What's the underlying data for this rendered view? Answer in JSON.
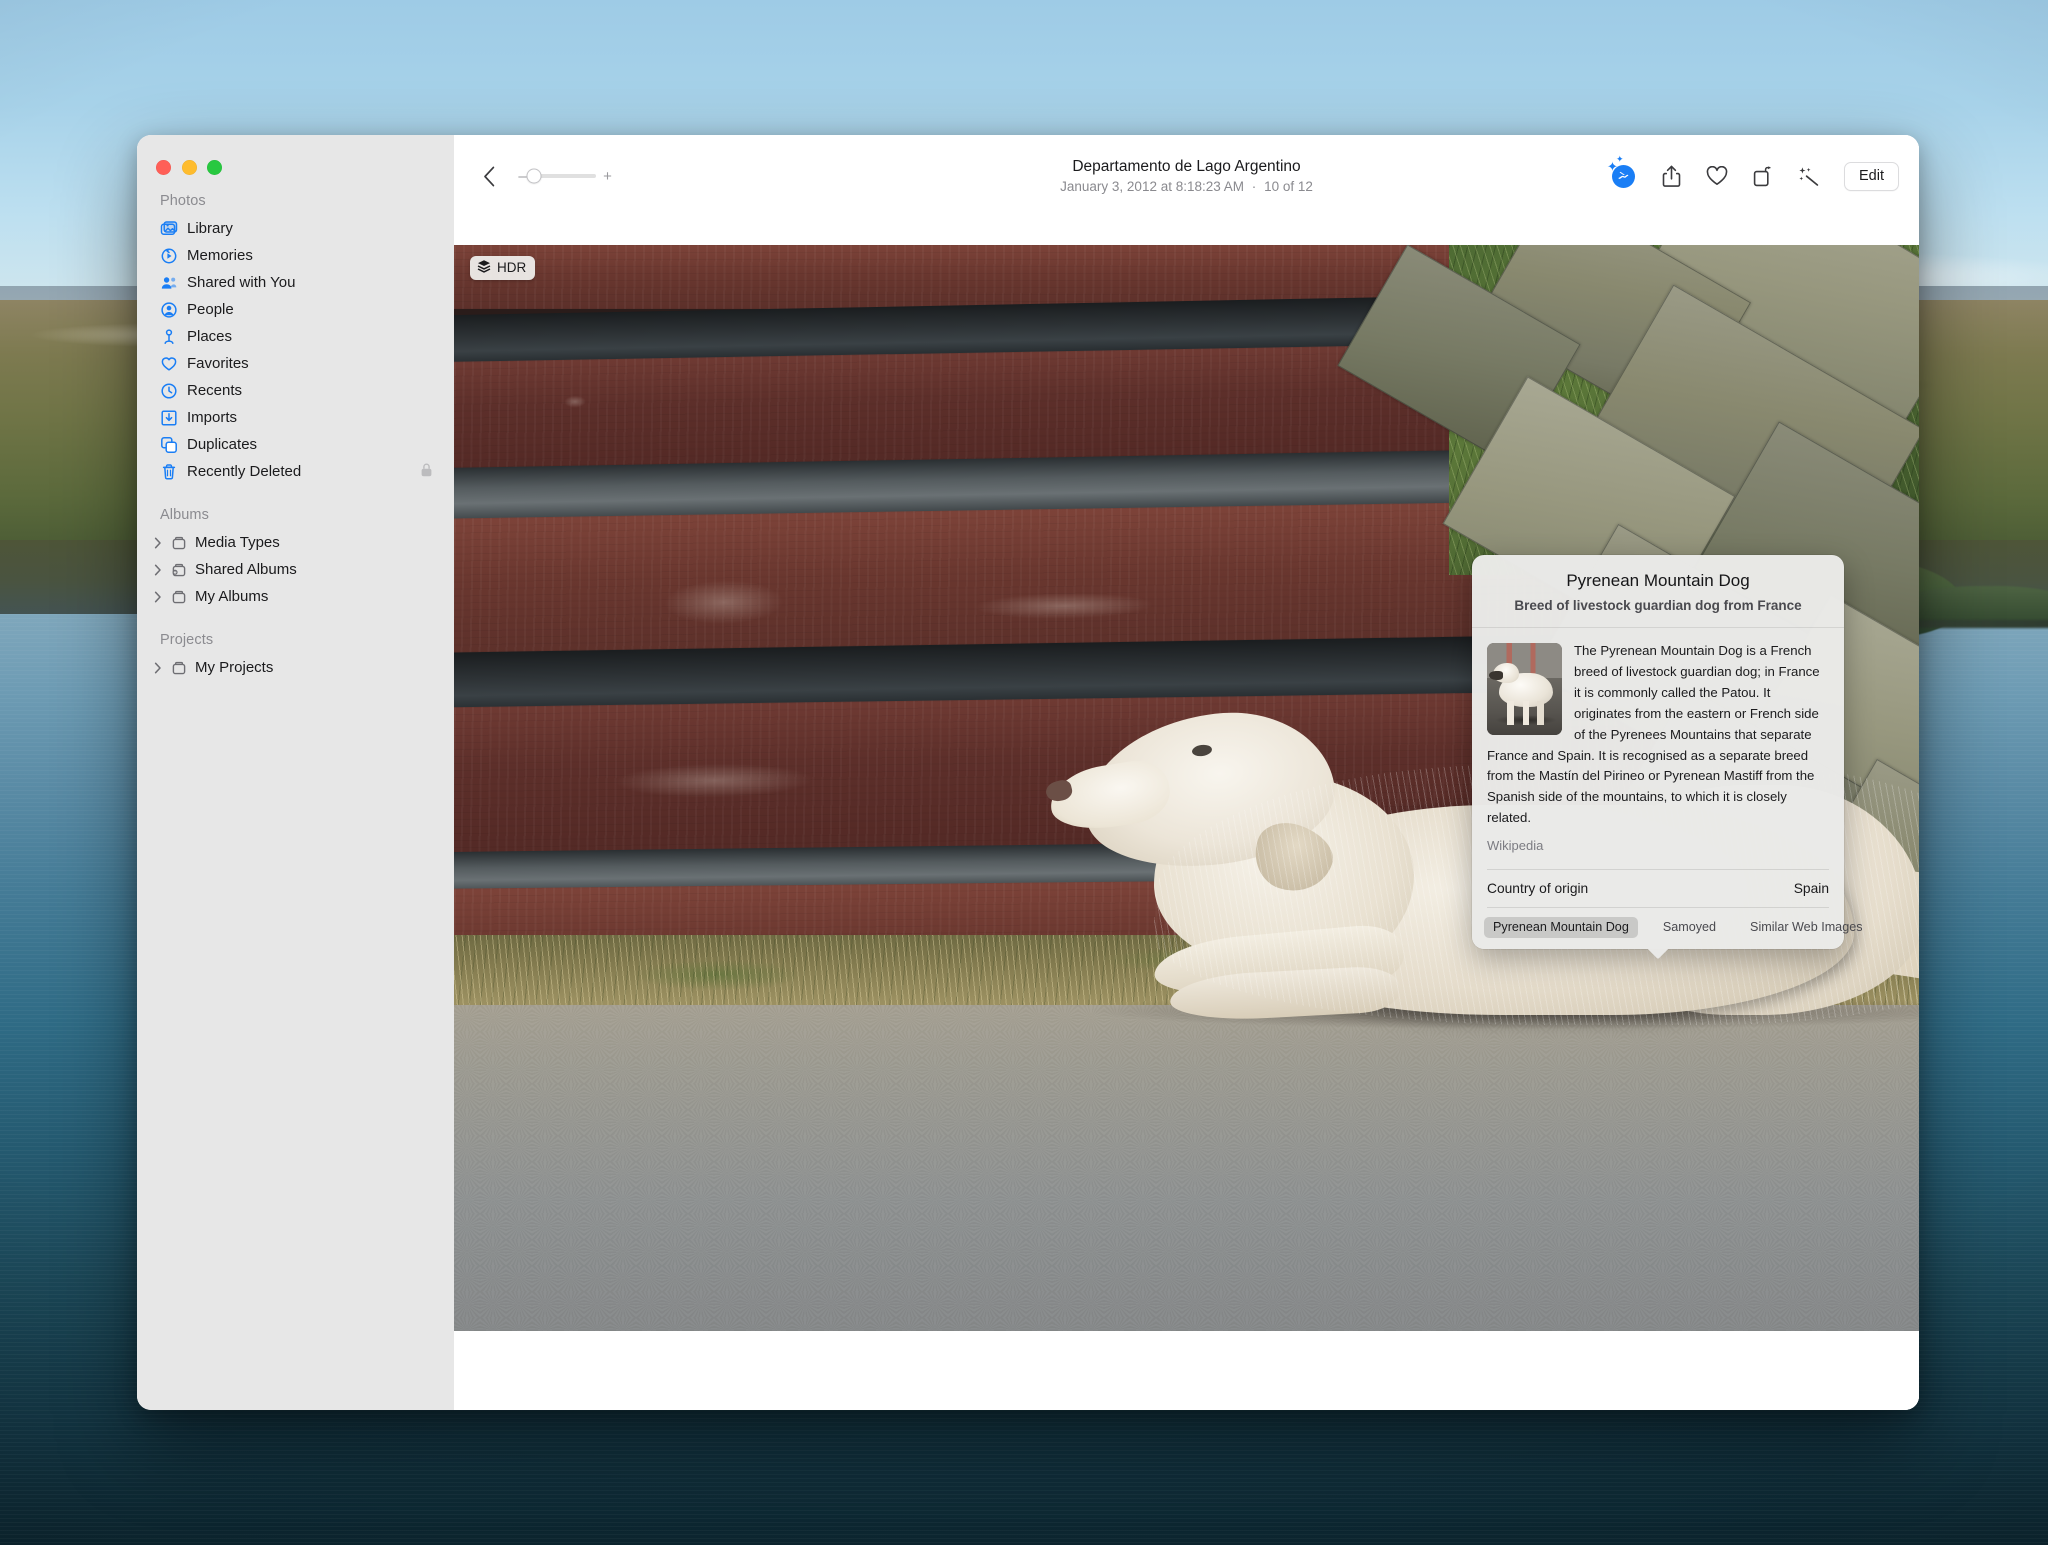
{
  "window": {
    "traffic_lights": [
      "close",
      "minimize",
      "zoom"
    ]
  },
  "sidebar": {
    "sections": [
      {
        "label": "Photos",
        "items": [
          {
            "label": "Library",
            "icon": "photo-library-icon"
          },
          {
            "label": "Memories",
            "icon": "memories-icon"
          },
          {
            "label": "Shared with You",
            "icon": "shared-with-you-icon"
          },
          {
            "label": "People",
            "icon": "people-icon"
          },
          {
            "label": "Places",
            "icon": "places-pin-icon"
          },
          {
            "label": "Favorites",
            "icon": "heart-icon"
          },
          {
            "label": "Recents",
            "icon": "clock-icon"
          },
          {
            "label": "Imports",
            "icon": "import-icon"
          },
          {
            "label": "Duplicates",
            "icon": "duplicates-icon"
          },
          {
            "label": "Recently Deleted",
            "icon": "trash-icon",
            "trailing_icon": "lock-icon"
          }
        ]
      },
      {
        "label": "Albums",
        "items": [
          {
            "label": "Media Types",
            "icon": "album-folder-icon",
            "disclosure": "chevron-right-icon"
          },
          {
            "label": "Shared Albums",
            "icon": "shared-album-icon",
            "disclosure": "chevron-right-icon"
          },
          {
            "label": "My Albums",
            "icon": "album-folder-icon",
            "disclosure": "chevron-right-icon"
          }
        ]
      },
      {
        "label": "Projects",
        "items": [
          {
            "label": "My Projects",
            "icon": "album-folder-icon",
            "disclosure": "chevron-right-icon"
          }
        ]
      }
    ]
  },
  "toolbar": {
    "back_icon": "chevron-left-icon",
    "zoom": {
      "minus": "–",
      "plus": "+",
      "value_percent": 0
    },
    "title": "Departamento de Lago Argentino",
    "date": "January 3, 2012 at 8:18:23 AM",
    "separator": "·",
    "position": "10 of 12",
    "actions": [
      {
        "name": "visual-look-up-button",
        "icon": "visual-look-up-icon",
        "active": true
      },
      {
        "name": "share-button",
        "icon": "share-icon",
        "active": false
      },
      {
        "name": "favorite-button",
        "icon": "heart-icon",
        "active": false
      },
      {
        "name": "rotate-button",
        "icon": "rotate-icon",
        "active": false
      },
      {
        "name": "auto-enhance-button",
        "icon": "magic-wand-icon",
        "active": false
      }
    ],
    "edit_label": "Edit"
  },
  "photo": {
    "hdr_badge": {
      "label": "HDR",
      "icon": "layers-icon"
    },
    "alt": "White Pyrenean Mountain Dog lying on dark red wooden steps beside a gray stone wall with gravel below"
  },
  "visual_lookup": {
    "title": "Pyrenean Mountain Dog",
    "subtitle": "Breed of livestock guardian dog from France",
    "thumbnail_alt": "White Pyrenean Mountain Dog standing outdoors",
    "description": "The Pyrenean Mountain Dog is a French breed of livestock guardian dog; in France it is commonly called the Patou. It originates from the eastern or French side of the Pyrenees Mountains that separate France and Spain. It is recognised as a separate breed from the Mastín del Pirineo or Pyrenean Mastiff from the Spanish side of the mountains, to which it is closely related.",
    "source": "Wikipedia",
    "fact": {
      "label": "Country of origin",
      "value": "Spain"
    },
    "tabs": [
      {
        "label": "Pyrenean Mountain Dog",
        "selected": true
      },
      {
        "label": "Samoyed",
        "selected": false
      },
      {
        "label": "Similar Web Images",
        "selected": false
      }
    ]
  },
  "colors": {
    "accent": "#1a7ef5",
    "sidebar_bg": "#e7e7e7",
    "window_bg": "#ffffff",
    "popover_bg": "#eaeae8"
  }
}
